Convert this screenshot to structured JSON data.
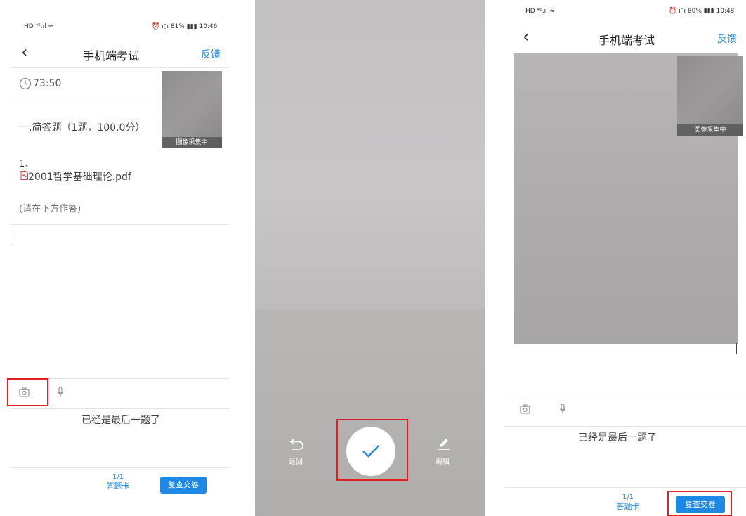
{
  "panel1": {
    "status_left": "HD ⁴⁶.ıl ≈",
    "status_right": "⏰ ı▯ı 81% ▮▮▮ 10:46",
    "title": "手机端考试",
    "feedback": "反馈",
    "timer": "73:50",
    "camera_label": "图像采集中",
    "section_heading": "一.简答题（1题，100.0分）",
    "question_number": "1、",
    "attachment_name": "2001哲学基础理论.pdf",
    "answer_hint": "(请在下方作答)",
    "last_question_text": "已经是最后一题了",
    "card_count": "1/1",
    "card_label": "答题卡",
    "submit_label": "复查交卷"
  },
  "panel2": {
    "back_label": "返回",
    "edit_label": "编辑"
  },
  "panel3": {
    "status_left": "HD ⁴⁶.ıl ≈",
    "status_right": "⏰ ı▯ı 80% ▮▮▮ 10:48",
    "title": "手机端考试",
    "feedback": "反馈",
    "camera_label": "图像采集中",
    "last_question_text": "已经是最后一题了",
    "card_count": "1/1",
    "card_label": "答题卡",
    "submit_label": "复查交卷"
  },
  "colors": {
    "accent": "#1e88e5",
    "highlight": "#e02020"
  }
}
